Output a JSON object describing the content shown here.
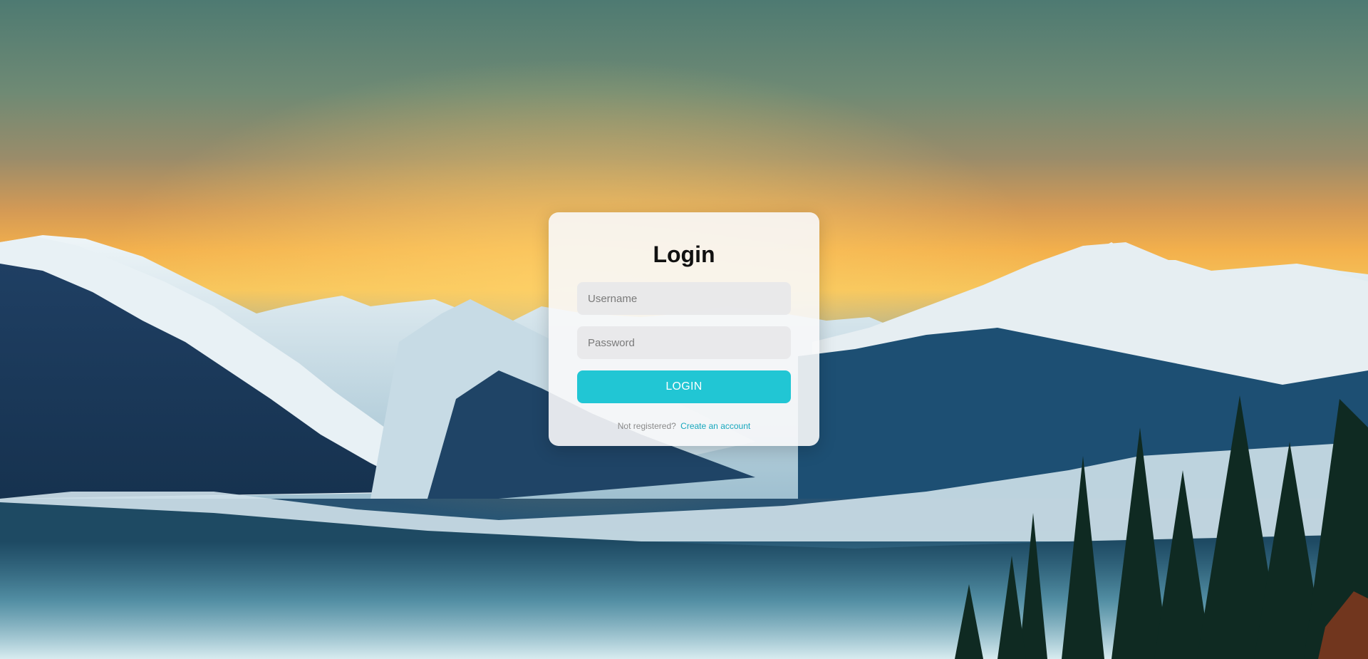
{
  "login": {
    "title": "Login",
    "username_placeholder": "Username",
    "password_placeholder": "Password",
    "button_label": "LOGIN",
    "footer_text": "Not registered?",
    "footer_link": "Create an account"
  },
  "colors": {
    "accent": "#21c6d4",
    "link": "#17a7bd",
    "card_background": "#f8f8fa"
  }
}
